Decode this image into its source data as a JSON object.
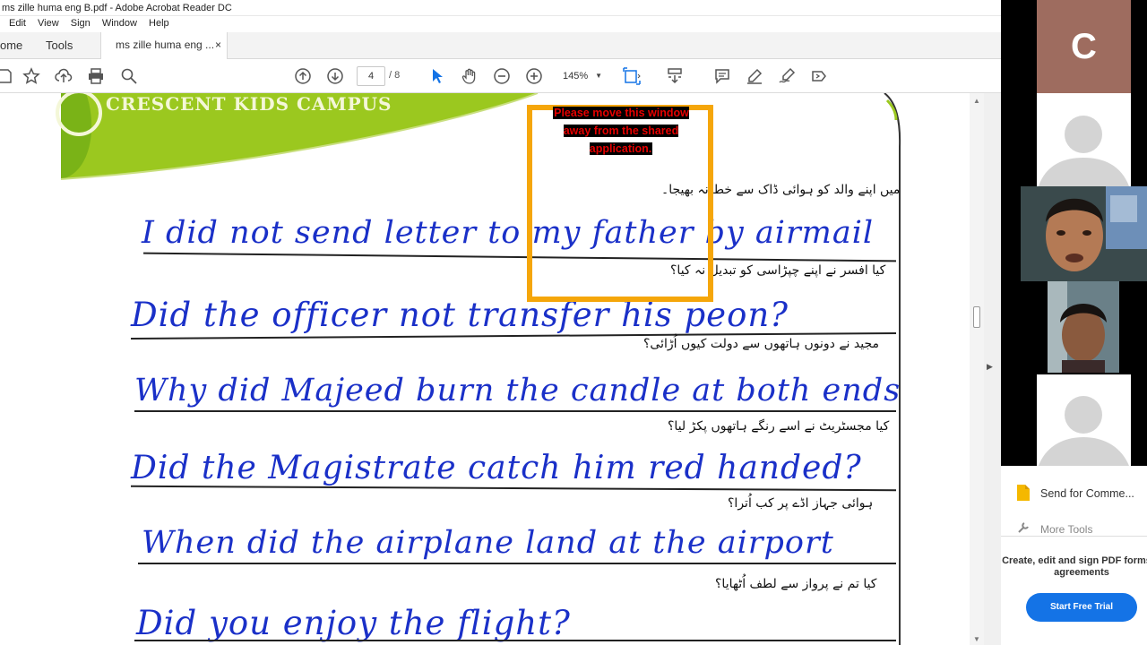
{
  "window": {
    "title": "ms zille huma eng B.pdf - Adobe Acrobat Reader DC"
  },
  "menu": [
    "Edit",
    "View",
    "Sign",
    "Window",
    "Help"
  ],
  "tabs": {
    "home": "ome",
    "tools": "Tools",
    "document": "ms zille huma eng ...",
    "close": "×"
  },
  "toolbar": {
    "current_page": "4",
    "total_pages": "/ 8",
    "zoom": "145%"
  },
  "document": {
    "header": "CRESCENT KIDS CAMPUS",
    "exercises": [
      {
        "urdu": "میں اپنے والد کو ہوائی ڈاک سے خط نہ بھیجا۔",
        "english": "I did not send letter to my father by airmail"
      },
      {
        "urdu": "کیا افسر نے اپنے چپڑاسی کو تبدیل نہ کیا؟",
        "english": "Did the officer not transfer his peon?"
      },
      {
        "urdu": "مجید نے دونوں ہاتھوں سے دولت کیوں اُڑائی؟",
        "english": "Why did Majeed burn the candle at both ends"
      },
      {
        "urdu": "کیا مجسٹریٹ نے اسے رنگے ہاتھوں پکڑ لیا؟",
        "english": "Did the Magistrate catch him red handed?"
      },
      {
        "urdu": "ہوائی جہاز اڈے پر کب اُترا؟",
        "english": "When did the airplane land at the airport"
      },
      {
        "urdu": "کیا تم نے پرواز سے لطف اُٹھایا؟",
        "english": "Did you enjoy the flight?"
      }
    ]
  },
  "share_warning": {
    "text": "Please move this window away from the shared application."
  },
  "participants": {
    "initial": "C",
    "initial_bg": "#9e6c5f"
  },
  "side_panel": {
    "send_for_comment": "Send for Comme...",
    "more_tools": "More Tools",
    "promo": "Create, edit and sign PDF forms & agreements",
    "trial_button": "Start Free Trial"
  },
  "colors": {
    "accent": "#1473e6",
    "share_border": "#f5a60a",
    "ink": "#1a30c8"
  }
}
